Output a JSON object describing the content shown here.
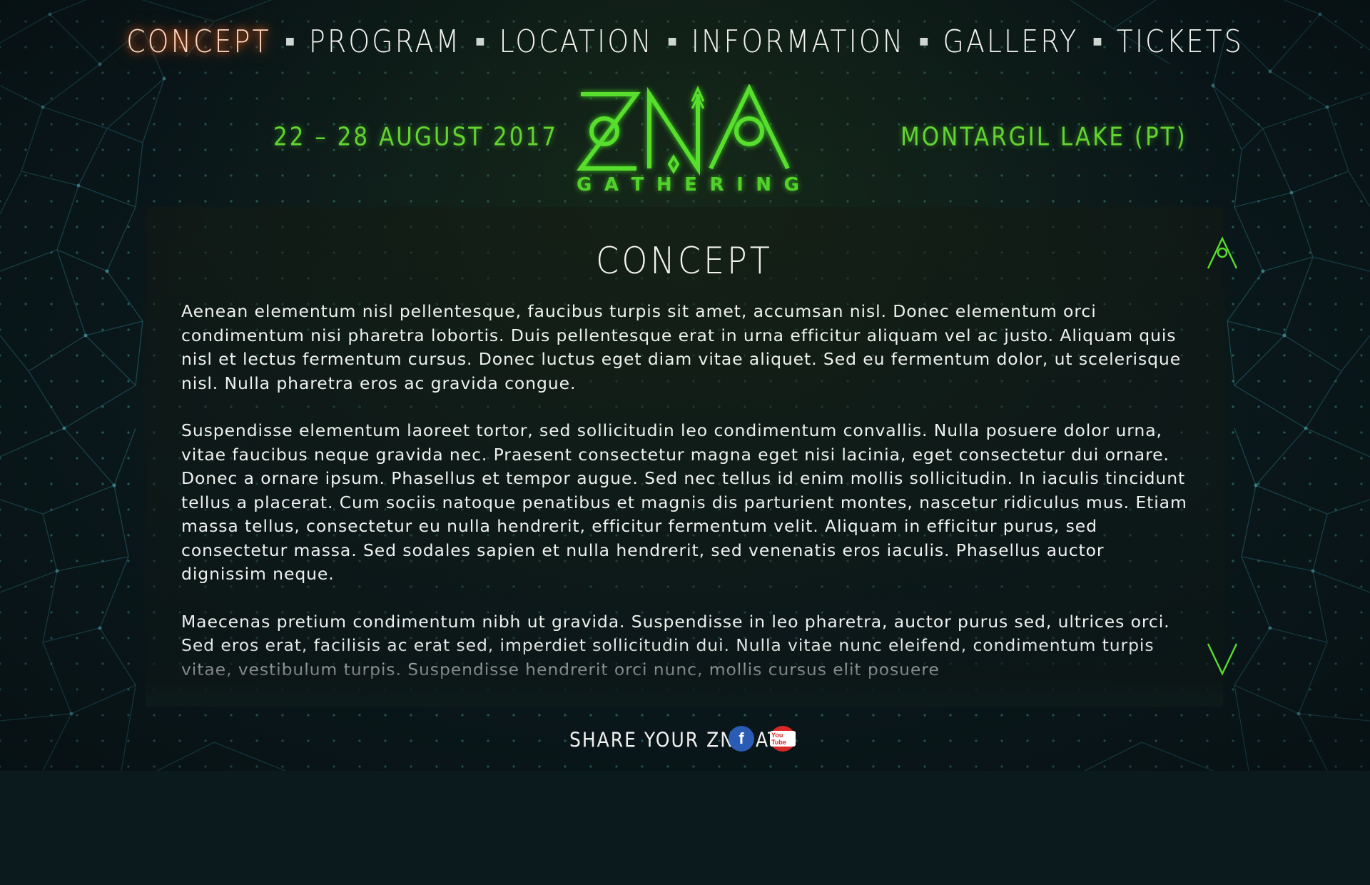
{
  "nav": {
    "items": [
      "CONCEPT",
      "PROGRAM",
      "LOCATION",
      "INFORMATION",
      "GALLERY",
      "TICKETS"
    ],
    "active": "CONCEPT"
  },
  "header": {
    "date": "22 – 28 AUGUST 2017",
    "location": "MONTARGIL LAKE (PT)",
    "logo_text": "ZNA",
    "logo_sub": [
      "G",
      "A",
      "T",
      "H",
      "E",
      "R",
      "I",
      "N",
      "G"
    ]
  },
  "concept": {
    "title": "CONCEPT",
    "paragraphs": [
      "Aenean elementum nisl pellentesque, faucibus turpis sit amet, accumsan nisl. Donec elementum orci condimentum nisi pharetra lobortis. Duis pellentesque erat in urna efficitur aliquam vel ac justo. Aliquam quis nisl et lectus fermentum cursus. Donec luctus eget diam vitae aliquet. Sed eu fermentum dolor, ut scelerisque nisl. Nulla pharetra eros ac gravida congue.",
      "Suspendisse elementum laoreet tortor, sed sollicitudin leo condimentum convallis. Nulla posuere dolor urna, vitae faucibus neque gravida nec. Praesent consectetur magna eget nisi lacinia, eget consectetur dui ornare. Donec a ornare ipsum. Phasellus et tempor augue. Sed nec tellus id enim mollis sollicitudin. In iaculis tincidunt tellus a placerat. Cum sociis natoque penatibus et magnis dis parturient montes, nascetur ridiculus mus. Etiam massa tellus, consectetur eu nulla hendrerit, efficitur fermentum velit. Aliquam in efficitur purus, sed consectetur massa. Sed sodales sapien et nulla hendrerit, sed venenatis eros iaculis. Phasellus auctor dignissim neque.",
      "Maecenas pretium condimentum nibh ut gravida. Suspendisse in leo pharetra, auctor purus sed, ultrices orci. Sed eros erat, facilisis ac erat sed, imperdiet sollicitudin dui. Nulla vitae nunc eleifend, condimentum turpis vitae, vestibulum turpis. Suspendisse hendrerit orci nunc, mollis cursus elit posuere"
    ]
  },
  "footer": {
    "share_label": "SHARE YOUR ZNA AT:",
    "facebook_glyph": "f",
    "youtube_glyph": "You Tube"
  },
  "colors": {
    "accent_green": "#52d12a",
    "active_glow": "#ff5a00",
    "facebook": "#2a5bb5",
    "youtube": "#d92727"
  },
  "icons": {
    "scroll_up": "scroll-up-icon",
    "scroll_down": "scroll-down-icon",
    "facebook": "facebook-icon",
    "youtube": "youtube-icon"
  }
}
